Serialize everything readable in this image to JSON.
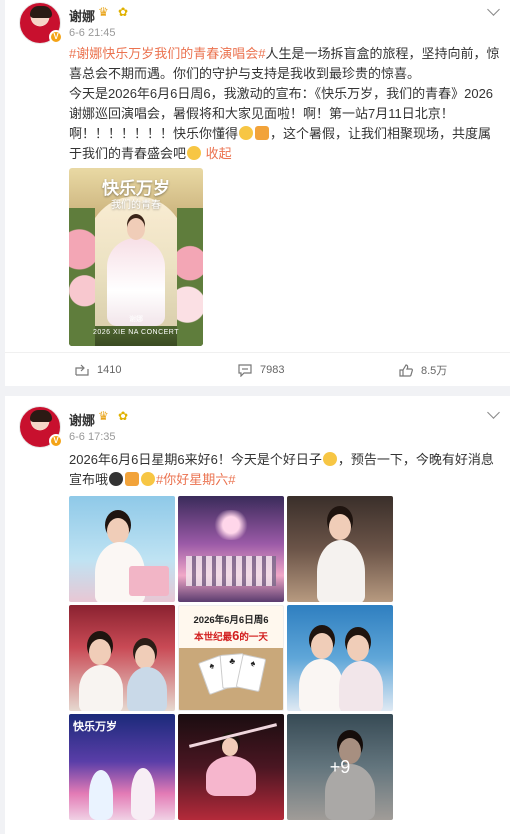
{
  "posts": [
    {
      "user": "谢娜",
      "time": "6-6 21:45",
      "topic": "#谢娜快乐万岁我们的青春演唱会#",
      "para1_rest": "人生是一场拆盲盒的旅程，坚持向前，惊喜总会不期而遇。你们的守护与支持是我收到最珍贵的惊喜。",
      "para2": "今天是2026年6月6日周6，我激动的宣布：《快乐万岁，我们的青春》2026谢娜巡回演唱会，暑假将和大家见面啦！啊！第一站7月11日北京！",
      "para3_a": "啊！！！！！！！快乐你懂得",
      "para3_b": "，这个暑假，让我们相聚现场，共度属于我们的青春盛会吧",
      "collapse": "收起",
      "poster": {
        "title": "快乐万岁",
        "subtitle": "我们的青春",
        "signature": "谢娜",
        "footer": "2026 XIE NA CONCERT"
      },
      "actions": {
        "share": "1410",
        "comment": "7983",
        "like": "8.5万"
      }
    },
    {
      "user": "谢娜",
      "time": "6-6 17:35",
      "text_a": "2026年6月6日星期6来好6！今天是个好日子",
      "text_b": "，预告一下，今晚有好消息宣布哦",
      "topic": "#你好星期六#",
      "photo_card": {
        "line1": "2026年6月6日周6",
        "line2a": "本世纪最",
        "line2b": "6",
        "line2c": "的一天"
      },
      "more_count": "+9"
    }
  ],
  "colors": {
    "topic": "#eb7350",
    "vip": "#f4a316"
  }
}
